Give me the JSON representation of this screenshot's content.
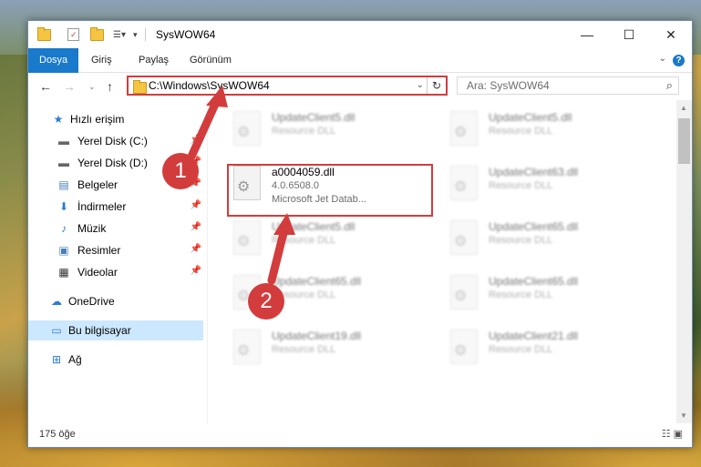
{
  "window": {
    "title": "SysWOW64",
    "controls": {
      "minimize": "—",
      "maximize": "☐",
      "close": "✕"
    }
  },
  "ribbon": {
    "tabs": [
      "Dosya",
      "Giriş",
      "Paylaş",
      "Görünüm"
    ],
    "help": "?"
  },
  "navigation": {
    "address": "C:\\Windows\\SysWOW64",
    "search_placeholder": "Ara: SysWOW64"
  },
  "sidebar": {
    "items": [
      {
        "label": "Hızlı erişim",
        "icon": "star-icon"
      },
      {
        "label": "Yerel Disk (C:)",
        "icon": "drive-icon"
      },
      {
        "label": "Yerel Disk (D:)",
        "icon": "drive-icon"
      },
      {
        "label": "Belgeler",
        "icon": "documents-icon"
      },
      {
        "label": "İndirmeler",
        "icon": "download-icon"
      },
      {
        "label": "Müzik",
        "icon": "music-icon"
      },
      {
        "label": "Resimler",
        "icon": "pictures-icon"
      },
      {
        "label": "Videolar",
        "icon": "videos-icon"
      },
      {
        "label": "OneDrive",
        "icon": "cloud-icon"
      },
      {
        "label": "Bu bilgisayar",
        "icon": "computer-icon"
      },
      {
        "label": "Ağ",
        "icon": "network-icon"
      }
    ]
  },
  "files": {
    "left": [
      {
        "name": "UpdateClient5.dll",
        "sub1": "Resource DLL",
        "sub2": ""
      },
      {
        "name": "a0004059.dll",
        "sub1": "4.0.6508.0",
        "sub2": "Microsoft Jet Datab..."
      },
      {
        "name": "UpdateClient5.dll",
        "sub1": "Resource DLL",
        "sub2": ""
      },
      {
        "name": "UpdateClient65.dll",
        "sub1": "Resource DLL",
        "sub2": ""
      },
      {
        "name": "UpdateClient19.dll",
        "sub1": "Resource DLL",
        "sub2": ""
      }
    ],
    "right": [
      {
        "name": "UpdateClient5.dll",
        "sub1": "Resource DLL"
      },
      {
        "name": "UpdateClient63.dll",
        "sub1": "Resource DLL"
      },
      {
        "name": "UpdateClient65.dll",
        "sub1": "Resource DLL"
      },
      {
        "name": "UpdateClient65.dll",
        "sub1": "Resource DLL"
      },
      {
        "name": "UpdateClient21.dll",
        "sub1": "Resource DLL"
      }
    ]
  },
  "status": {
    "count": "175 öğe"
  },
  "annotations": {
    "step1": "1",
    "step2": "2",
    "color": "#d33c3c"
  }
}
